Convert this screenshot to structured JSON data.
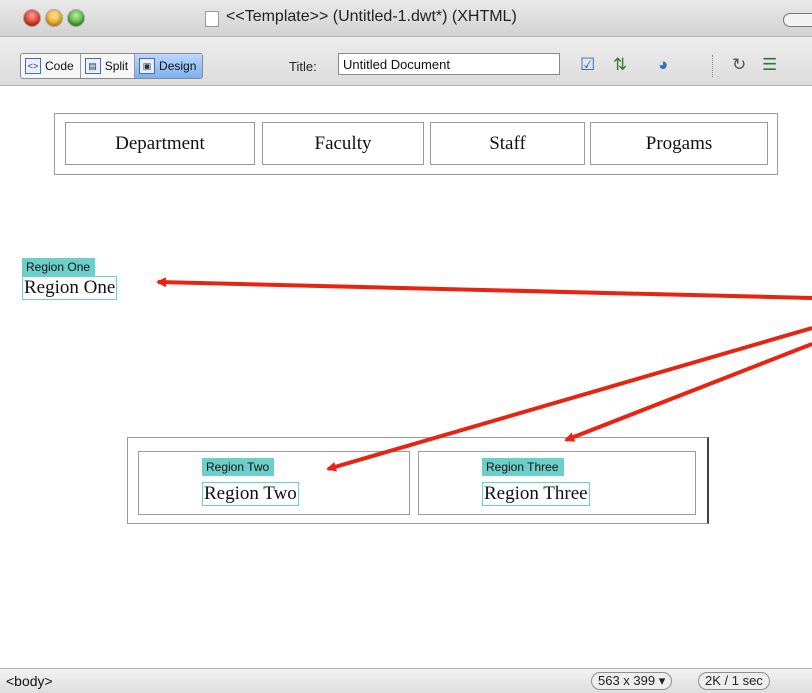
{
  "window": {
    "title": "<<Template>>  (Untitled-1.dwt*) (XHTML)"
  },
  "toolbar": {
    "view_buttons": [
      {
        "label": "Code",
        "icon": "code-view-icon"
      },
      {
        "label": "Split",
        "icon": "split-view-icon"
      },
      {
        "label": "Design",
        "icon": "design-view-icon",
        "active": true
      }
    ],
    "title_label": "Title:",
    "title_value": "Untitled Document",
    "icons": [
      "validate-markup-icon",
      "file-management-icon",
      "preview-browser-icon",
      "refresh-icon",
      "view-options-icon"
    ]
  },
  "nav": {
    "cells": [
      "Department",
      "Faculty",
      "Staff",
      "Progams"
    ]
  },
  "regions": {
    "one": {
      "tag": "Region One",
      "content": "Region One"
    },
    "two": {
      "tag": "Region Two",
      "content": "Region Two"
    },
    "three": {
      "tag": "Region Three",
      "content": "Region Three"
    }
  },
  "annotation_arrow_color": "#e8230f",
  "region_highlight_color": "#6dcfc9",
  "status": {
    "tag_selector": "<body>",
    "window_size": "563 x 399",
    "download": "2K / 1 sec"
  }
}
